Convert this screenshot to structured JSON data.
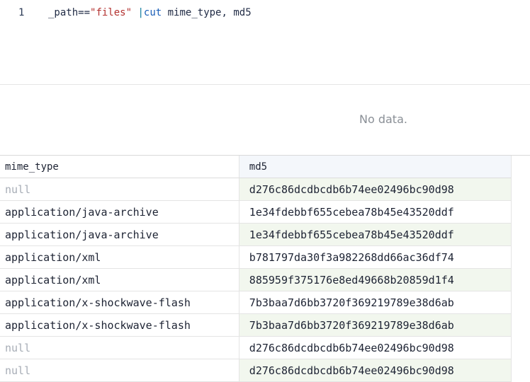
{
  "editor": {
    "line_number": "1",
    "tokens": {
      "field": "_path==",
      "string": "\"files\"",
      "pipe": " |",
      "command": "cut",
      "args": " mime_type, md5"
    }
  },
  "results": {
    "empty_message": "No data."
  },
  "table": {
    "columns": [
      "mime_type",
      "md5"
    ],
    "rows": [
      {
        "mime_type": "null",
        "md5": "d276c86dcdbcdb6b74ee02496bc90d98"
      },
      {
        "mime_type": "application/java-archive",
        "md5": "1e34fdebbf655cebea78b45e43520ddf"
      },
      {
        "mime_type": "application/java-archive",
        "md5": "1e34fdebbf655cebea78b45e43520ddf"
      },
      {
        "mime_type": "application/xml",
        "md5": "b781797da30f3a982268dd66ac36df74"
      },
      {
        "mime_type": "application/xml",
        "md5": "885959f375176e8ed49668b20859d1f4"
      },
      {
        "mime_type": "application/x-shockwave-flash",
        "md5": "7b3baa7d6bb3720f369219789e38d6ab"
      },
      {
        "mime_type": "application/x-shockwave-flash",
        "md5": "7b3baa7d6bb3720f369219789e38d6ab"
      },
      {
        "mime_type": "null",
        "md5": "d276c86dcdbcdb6b74ee02496bc90d98"
      },
      {
        "mime_type": "null",
        "md5": "d276c86dcdbcdb6b74ee02496bc90d98"
      }
    ]
  }
}
